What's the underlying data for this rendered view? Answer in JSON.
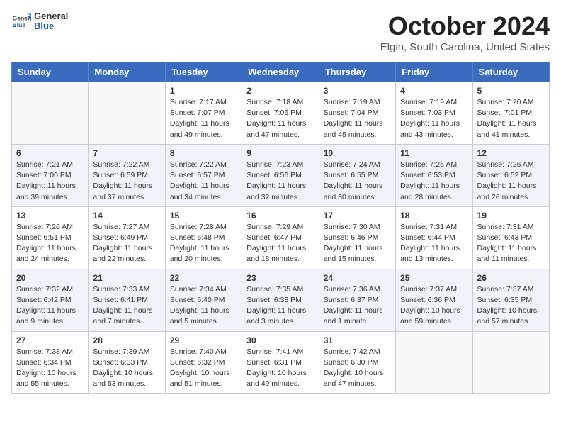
{
  "header": {
    "logo_general": "General",
    "logo_blue": "Blue",
    "title": "October 2024",
    "location": "Elgin, South Carolina, United States"
  },
  "columns": [
    "Sunday",
    "Monday",
    "Tuesday",
    "Wednesday",
    "Thursday",
    "Friday",
    "Saturday"
  ],
  "weeks": [
    [
      {
        "day": "",
        "sunrise": "",
        "sunset": "",
        "daylight": ""
      },
      {
        "day": "",
        "sunrise": "",
        "sunset": "",
        "daylight": ""
      },
      {
        "day": "1",
        "sunrise": "Sunrise: 7:17 AM",
        "sunset": "Sunset: 7:07 PM",
        "daylight": "Daylight: 11 hours and 49 minutes."
      },
      {
        "day": "2",
        "sunrise": "Sunrise: 7:18 AM",
        "sunset": "Sunset: 7:06 PM",
        "daylight": "Daylight: 11 hours and 47 minutes."
      },
      {
        "day": "3",
        "sunrise": "Sunrise: 7:19 AM",
        "sunset": "Sunset: 7:04 PM",
        "daylight": "Daylight: 11 hours and 45 minutes."
      },
      {
        "day": "4",
        "sunrise": "Sunrise: 7:19 AM",
        "sunset": "Sunset: 7:03 PM",
        "daylight": "Daylight: 11 hours and 43 minutes."
      },
      {
        "day": "5",
        "sunrise": "Sunrise: 7:20 AM",
        "sunset": "Sunset: 7:01 PM",
        "daylight": "Daylight: 11 hours and 41 minutes."
      }
    ],
    [
      {
        "day": "6",
        "sunrise": "Sunrise: 7:21 AM",
        "sunset": "Sunset: 7:00 PM",
        "daylight": "Daylight: 11 hours and 39 minutes."
      },
      {
        "day": "7",
        "sunrise": "Sunrise: 7:22 AM",
        "sunset": "Sunset: 6:59 PM",
        "daylight": "Daylight: 11 hours and 37 minutes."
      },
      {
        "day": "8",
        "sunrise": "Sunrise: 7:22 AM",
        "sunset": "Sunset: 6:57 PM",
        "daylight": "Daylight: 11 hours and 34 minutes."
      },
      {
        "day": "9",
        "sunrise": "Sunrise: 7:23 AM",
        "sunset": "Sunset: 6:56 PM",
        "daylight": "Daylight: 11 hours and 32 minutes."
      },
      {
        "day": "10",
        "sunrise": "Sunrise: 7:24 AM",
        "sunset": "Sunset: 6:55 PM",
        "daylight": "Daylight: 11 hours and 30 minutes."
      },
      {
        "day": "11",
        "sunrise": "Sunrise: 7:25 AM",
        "sunset": "Sunset: 6:53 PM",
        "daylight": "Daylight: 11 hours and 28 minutes."
      },
      {
        "day": "12",
        "sunrise": "Sunrise: 7:26 AM",
        "sunset": "Sunset: 6:52 PM",
        "daylight": "Daylight: 11 hours and 26 minutes."
      }
    ],
    [
      {
        "day": "13",
        "sunrise": "Sunrise: 7:26 AM",
        "sunset": "Sunset: 6:51 PM",
        "daylight": "Daylight: 11 hours and 24 minutes."
      },
      {
        "day": "14",
        "sunrise": "Sunrise: 7:27 AM",
        "sunset": "Sunset: 6:49 PM",
        "daylight": "Daylight: 11 hours and 22 minutes."
      },
      {
        "day": "15",
        "sunrise": "Sunrise: 7:28 AM",
        "sunset": "Sunset: 6:48 PM",
        "daylight": "Daylight: 11 hours and 20 minutes."
      },
      {
        "day": "16",
        "sunrise": "Sunrise: 7:29 AM",
        "sunset": "Sunset: 6:47 PM",
        "daylight": "Daylight: 11 hours and 18 minutes."
      },
      {
        "day": "17",
        "sunrise": "Sunrise: 7:30 AM",
        "sunset": "Sunset: 6:46 PM",
        "daylight": "Daylight: 11 hours and 15 minutes."
      },
      {
        "day": "18",
        "sunrise": "Sunrise: 7:31 AM",
        "sunset": "Sunset: 6:44 PM",
        "daylight": "Daylight: 11 hours and 13 minutes."
      },
      {
        "day": "19",
        "sunrise": "Sunrise: 7:31 AM",
        "sunset": "Sunset: 6:43 PM",
        "daylight": "Daylight: 11 hours and 11 minutes."
      }
    ],
    [
      {
        "day": "20",
        "sunrise": "Sunrise: 7:32 AM",
        "sunset": "Sunset: 6:42 PM",
        "daylight": "Daylight: 11 hours and 9 minutes."
      },
      {
        "day": "21",
        "sunrise": "Sunrise: 7:33 AM",
        "sunset": "Sunset: 6:41 PM",
        "daylight": "Daylight: 11 hours and 7 minutes."
      },
      {
        "day": "22",
        "sunrise": "Sunrise: 7:34 AM",
        "sunset": "Sunset: 6:40 PM",
        "daylight": "Daylight: 11 hours and 5 minutes."
      },
      {
        "day": "23",
        "sunrise": "Sunrise: 7:35 AM",
        "sunset": "Sunset: 6:38 PM",
        "daylight": "Daylight: 11 hours and 3 minutes."
      },
      {
        "day": "24",
        "sunrise": "Sunrise: 7:36 AM",
        "sunset": "Sunset: 6:37 PM",
        "daylight": "Daylight: 11 hours and 1 minute."
      },
      {
        "day": "25",
        "sunrise": "Sunrise: 7:37 AM",
        "sunset": "Sunset: 6:36 PM",
        "daylight": "Daylight: 10 hours and 59 minutes."
      },
      {
        "day": "26",
        "sunrise": "Sunrise: 7:37 AM",
        "sunset": "Sunset: 6:35 PM",
        "daylight": "Daylight: 10 hours and 57 minutes."
      }
    ],
    [
      {
        "day": "27",
        "sunrise": "Sunrise: 7:38 AM",
        "sunset": "Sunset: 6:34 PM",
        "daylight": "Daylight: 10 hours and 55 minutes."
      },
      {
        "day": "28",
        "sunrise": "Sunrise: 7:39 AM",
        "sunset": "Sunset: 6:33 PM",
        "daylight": "Daylight: 10 hours and 53 minutes."
      },
      {
        "day": "29",
        "sunrise": "Sunrise: 7:40 AM",
        "sunset": "Sunset: 6:32 PM",
        "daylight": "Daylight: 10 hours and 51 minutes."
      },
      {
        "day": "30",
        "sunrise": "Sunrise: 7:41 AM",
        "sunset": "Sunset: 6:31 PM",
        "daylight": "Daylight: 10 hours and 49 minutes."
      },
      {
        "day": "31",
        "sunrise": "Sunrise: 7:42 AM",
        "sunset": "Sunset: 6:30 PM",
        "daylight": "Daylight: 10 hours and 47 minutes."
      },
      {
        "day": "",
        "sunrise": "",
        "sunset": "",
        "daylight": ""
      },
      {
        "day": "",
        "sunrise": "",
        "sunset": "",
        "daylight": ""
      }
    ]
  ]
}
